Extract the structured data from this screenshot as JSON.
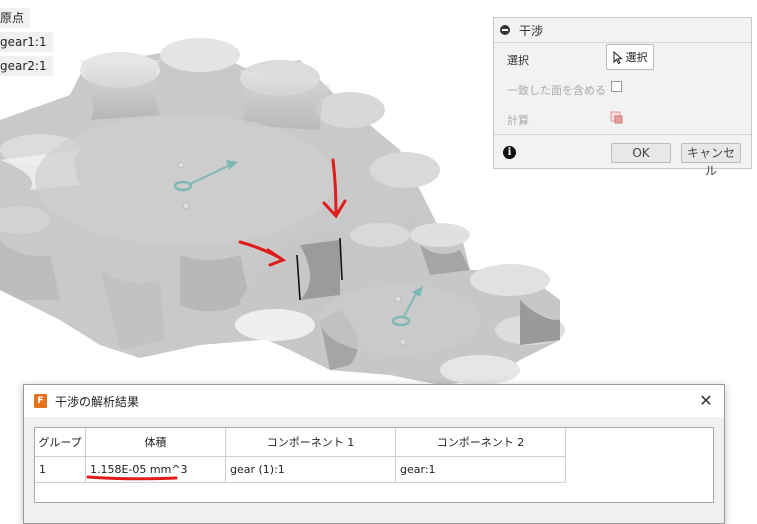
{
  "browser": {
    "items": [
      {
        "label": "原点"
      },
      {
        "label": "gear1:1"
      },
      {
        "label": "gear2:1"
      }
    ]
  },
  "panel": {
    "title": "干渉",
    "selection_label": "選択",
    "select_button_label": "選択",
    "include_faces_label": "一致した面を含める",
    "include_faces_checked": false,
    "compute_label": "計算",
    "ok_label": "OK",
    "cancel_label": "キャンセル",
    "info_icon": "info-icon"
  },
  "dialog": {
    "title": "干渉の解析結果",
    "app_icon_letter": "F",
    "columns": [
      "グループ",
      "体積",
      "コンポーネント 1",
      "コンポーネント 2"
    ],
    "rows": [
      [
        "1",
        "1.158E-05 mm^3",
        "gear (1):1",
        "gear:1"
      ]
    ]
  },
  "colors": {
    "annotation_red": "#e01b1b",
    "app_orange": "#e8731f",
    "triad_teal": "#7fb9b5"
  }
}
